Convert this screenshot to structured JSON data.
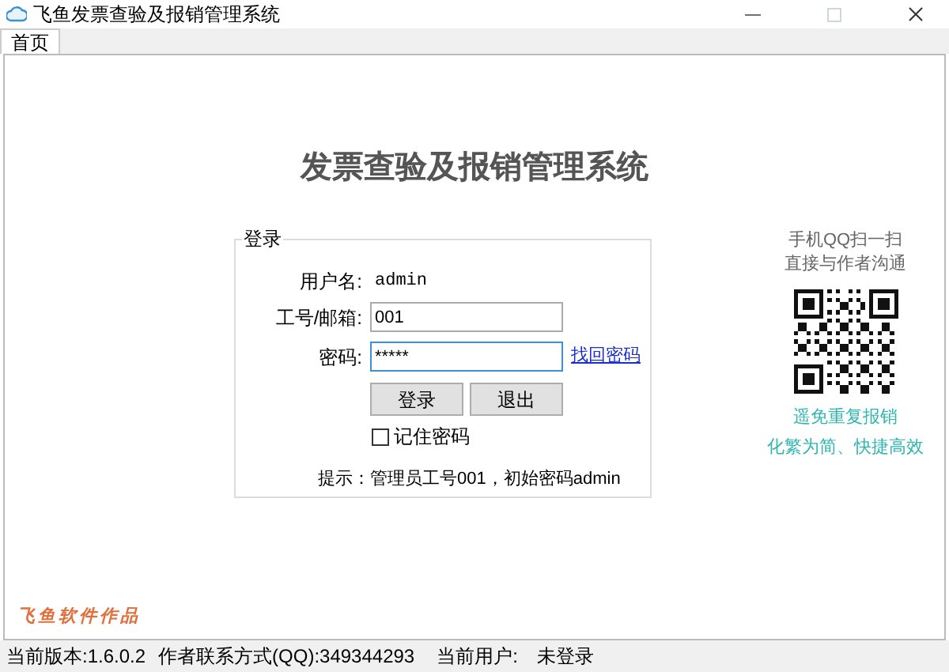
{
  "window": {
    "title": "飞鱼发票查验及报销管理系统"
  },
  "tabs": [
    {
      "label": "首页",
      "selected": true
    }
  ],
  "heading": "发票查验及报销管理系统",
  "login": {
    "group_title": "登录",
    "username": {
      "label": "用户名:",
      "value": "admin"
    },
    "employee_id": {
      "label": "工号/邮箱:",
      "value": "001"
    },
    "password": {
      "label": "密码:",
      "value": "*****",
      "link": "找回密码"
    },
    "buttons": [
      {
        "label": "登录"
      },
      {
        "label": "退出"
      }
    ],
    "remember": {
      "label": "记住密码",
      "checked": false
    },
    "hint": "提示：管理员工号001，初始密码admin"
  },
  "qr_panel": {
    "caption": [
      "手机QQ扫一扫",
      "直接与作者沟通"
    ],
    "slogans": [
      "遥免重复报销",
      "化繁为简、快捷高效"
    ]
  },
  "signature": "飞鱼软件作品",
  "status_bar": {
    "version": "当前版本:1.6.0.2",
    "contact": "作者联系方式(QQ):349344293",
    "user_label": "当前用户:",
    "user_value": "未登录"
  }
}
